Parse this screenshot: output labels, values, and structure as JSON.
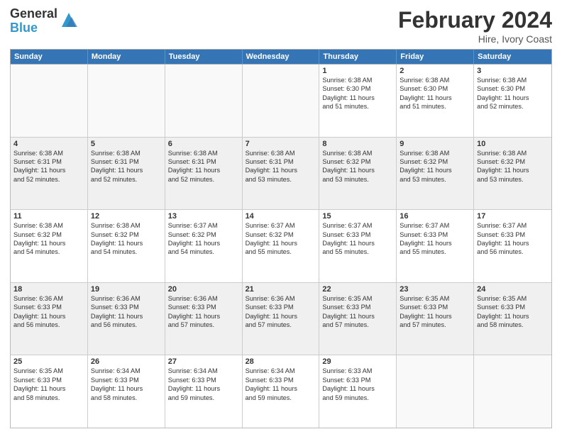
{
  "header": {
    "logo_general": "General",
    "logo_blue": "Blue",
    "month_title": "February 2024",
    "location": "Hire, Ivory Coast"
  },
  "weekdays": [
    "Sunday",
    "Monday",
    "Tuesday",
    "Wednesday",
    "Thursday",
    "Friday",
    "Saturday"
  ],
  "rows": [
    [
      {
        "day": "",
        "lines": [],
        "empty": true
      },
      {
        "day": "",
        "lines": [],
        "empty": true
      },
      {
        "day": "",
        "lines": [],
        "empty": true
      },
      {
        "day": "",
        "lines": [],
        "empty": true
      },
      {
        "day": "1",
        "lines": [
          "Sunrise: 6:38 AM",
          "Sunset: 6:30 PM",
          "Daylight: 11 hours",
          "and 51 minutes."
        ]
      },
      {
        "day": "2",
        "lines": [
          "Sunrise: 6:38 AM",
          "Sunset: 6:30 PM",
          "Daylight: 11 hours",
          "and 51 minutes."
        ]
      },
      {
        "day": "3",
        "lines": [
          "Sunrise: 6:38 AM",
          "Sunset: 6:30 PM",
          "Daylight: 11 hours",
          "and 52 minutes."
        ]
      }
    ],
    [
      {
        "day": "4",
        "lines": [
          "Sunrise: 6:38 AM",
          "Sunset: 6:31 PM",
          "Daylight: 11 hours",
          "and 52 minutes."
        ]
      },
      {
        "day": "5",
        "lines": [
          "Sunrise: 6:38 AM",
          "Sunset: 6:31 PM",
          "Daylight: 11 hours",
          "and 52 minutes."
        ]
      },
      {
        "day": "6",
        "lines": [
          "Sunrise: 6:38 AM",
          "Sunset: 6:31 PM",
          "Daylight: 11 hours",
          "and 52 minutes."
        ]
      },
      {
        "day": "7",
        "lines": [
          "Sunrise: 6:38 AM",
          "Sunset: 6:31 PM",
          "Daylight: 11 hours",
          "and 53 minutes."
        ]
      },
      {
        "day": "8",
        "lines": [
          "Sunrise: 6:38 AM",
          "Sunset: 6:32 PM",
          "Daylight: 11 hours",
          "and 53 minutes."
        ]
      },
      {
        "day": "9",
        "lines": [
          "Sunrise: 6:38 AM",
          "Sunset: 6:32 PM",
          "Daylight: 11 hours",
          "and 53 minutes."
        ]
      },
      {
        "day": "10",
        "lines": [
          "Sunrise: 6:38 AM",
          "Sunset: 6:32 PM",
          "Daylight: 11 hours",
          "and 53 minutes."
        ]
      }
    ],
    [
      {
        "day": "11",
        "lines": [
          "Sunrise: 6:38 AM",
          "Sunset: 6:32 PM",
          "Daylight: 11 hours",
          "and 54 minutes."
        ]
      },
      {
        "day": "12",
        "lines": [
          "Sunrise: 6:38 AM",
          "Sunset: 6:32 PM",
          "Daylight: 11 hours",
          "and 54 minutes."
        ]
      },
      {
        "day": "13",
        "lines": [
          "Sunrise: 6:37 AM",
          "Sunset: 6:32 PM",
          "Daylight: 11 hours",
          "and 54 minutes."
        ]
      },
      {
        "day": "14",
        "lines": [
          "Sunrise: 6:37 AM",
          "Sunset: 6:32 PM",
          "Daylight: 11 hours",
          "and 55 minutes."
        ]
      },
      {
        "day": "15",
        "lines": [
          "Sunrise: 6:37 AM",
          "Sunset: 6:33 PM",
          "Daylight: 11 hours",
          "and 55 minutes."
        ]
      },
      {
        "day": "16",
        "lines": [
          "Sunrise: 6:37 AM",
          "Sunset: 6:33 PM",
          "Daylight: 11 hours",
          "and 55 minutes."
        ]
      },
      {
        "day": "17",
        "lines": [
          "Sunrise: 6:37 AM",
          "Sunset: 6:33 PM",
          "Daylight: 11 hours",
          "and 56 minutes."
        ]
      }
    ],
    [
      {
        "day": "18",
        "lines": [
          "Sunrise: 6:36 AM",
          "Sunset: 6:33 PM",
          "Daylight: 11 hours",
          "and 56 minutes."
        ]
      },
      {
        "day": "19",
        "lines": [
          "Sunrise: 6:36 AM",
          "Sunset: 6:33 PM",
          "Daylight: 11 hours",
          "and 56 minutes."
        ]
      },
      {
        "day": "20",
        "lines": [
          "Sunrise: 6:36 AM",
          "Sunset: 6:33 PM",
          "Daylight: 11 hours",
          "and 57 minutes."
        ]
      },
      {
        "day": "21",
        "lines": [
          "Sunrise: 6:36 AM",
          "Sunset: 6:33 PM",
          "Daylight: 11 hours",
          "and 57 minutes."
        ]
      },
      {
        "day": "22",
        "lines": [
          "Sunrise: 6:35 AM",
          "Sunset: 6:33 PM",
          "Daylight: 11 hours",
          "and 57 minutes."
        ]
      },
      {
        "day": "23",
        "lines": [
          "Sunrise: 6:35 AM",
          "Sunset: 6:33 PM",
          "Daylight: 11 hours",
          "and 57 minutes."
        ]
      },
      {
        "day": "24",
        "lines": [
          "Sunrise: 6:35 AM",
          "Sunset: 6:33 PM",
          "Daylight: 11 hours",
          "and 58 minutes."
        ]
      }
    ],
    [
      {
        "day": "25",
        "lines": [
          "Sunrise: 6:35 AM",
          "Sunset: 6:33 PM",
          "Daylight: 11 hours",
          "and 58 minutes."
        ]
      },
      {
        "day": "26",
        "lines": [
          "Sunrise: 6:34 AM",
          "Sunset: 6:33 PM",
          "Daylight: 11 hours",
          "and 58 minutes."
        ]
      },
      {
        "day": "27",
        "lines": [
          "Sunrise: 6:34 AM",
          "Sunset: 6:33 PM",
          "Daylight: 11 hours",
          "and 59 minutes."
        ]
      },
      {
        "day": "28",
        "lines": [
          "Sunrise: 6:34 AM",
          "Sunset: 6:33 PM",
          "Daylight: 11 hours",
          "and 59 minutes."
        ]
      },
      {
        "day": "29",
        "lines": [
          "Sunrise: 6:33 AM",
          "Sunset: 6:33 PM",
          "Daylight: 11 hours",
          "and 59 minutes."
        ]
      },
      {
        "day": "",
        "lines": [],
        "empty": true
      },
      {
        "day": "",
        "lines": [],
        "empty": true
      }
    ]
  ]
}
